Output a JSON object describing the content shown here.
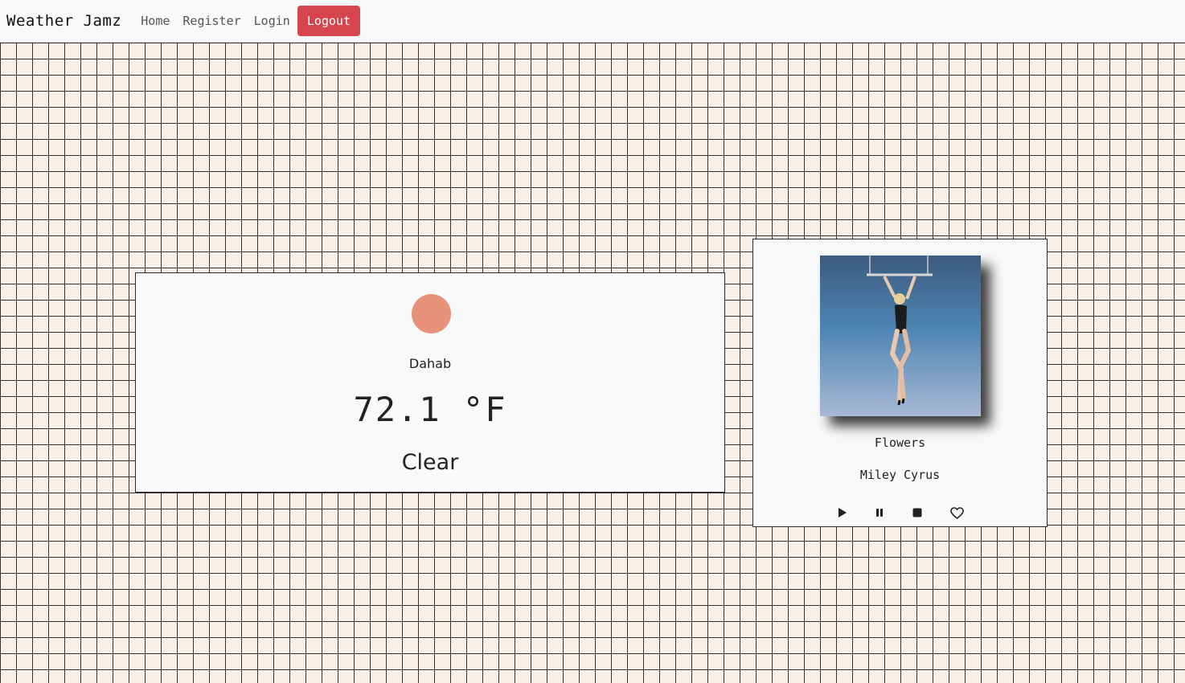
{
  "nav": {
    "brand": "Weather Jamz",
    "links": [
      "Home",
      "Register",
      "Login"
    ],
    "logout_label": "Logout"
  },
  "weather": {
    "city": "Dahab",
    "temperature": "72.1 °F",
    "condition": "Clear",
    "icon": "sun-icon",
    "icon_color": "#e79379"
  },
  "music": {
    "song_title": "Flowers",
    "artist": "Miley Cyrus",
    "controls": [
      "play-icon",
      "pause-icon",
      "stop-icon",
      "heart-icon"
    ]
  },
  "colors": {
    "logout": "#d6454d",
    "grid_line": "#3a2e2b",
    "grid_bg": "#f8efe9"
  }
}
